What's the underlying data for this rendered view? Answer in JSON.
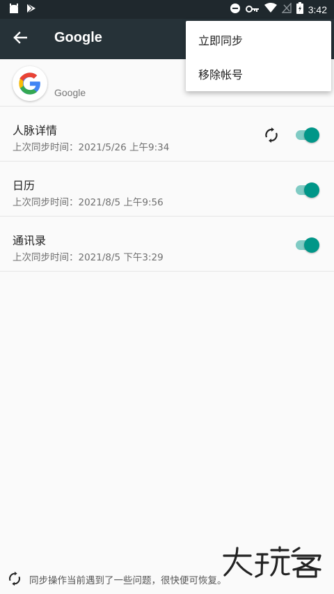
{
  "status_bar": {
    "time": "3:42",
    "icons": [
      "android-icon",
      "play-store-icon",
      "dnd-icon",
      "vpn-key-icon",
      "wifi-icon",
      "no-signal-icon",
      "battery-icon"
    ]
  },
  "app_bar": {
    "title": "Google",
    "back_icon": "arrow-back-icon"
  },
  "account": {
    "label": "Google",
    "logo": "google-g-icon"
  },
  "overflow_menu": {
    "items": [
      {
        "label": "立即同步"
      },
      {
        "label": "移除帐号"
      }
    ]
  },
  "sync_items": [
    {
      "title": "人脉详情",
      "subtitle": "上次同步时间：2021/5/26 上午9:34",
      "enabled": true,
      "syncing": true
    },
    {
      "title": "日历",
      "subtitle": "上次同步时间：2021/8/5 上午9:56",
      "enabled": true,
      "syncing": false
    },
    {
      "title": "通讯录",
      "subtitle": "上次同步时间：2021/8/5 下午3:29",
      "enabled": true,
      "syncing": false
    }
  ],
  "footer": {
    "message": "同步操作当前遇到了一些问题，很快便可恢复。"
  },
  "watermark": {
    "text": "大玩客"
  },
  "colors": {
    "status_bar": "#1f282d",
    "app_bar": "#263238",
    "switch_thumb": "#009688",
    "switch_track": "#80cbc4"
  }
}
